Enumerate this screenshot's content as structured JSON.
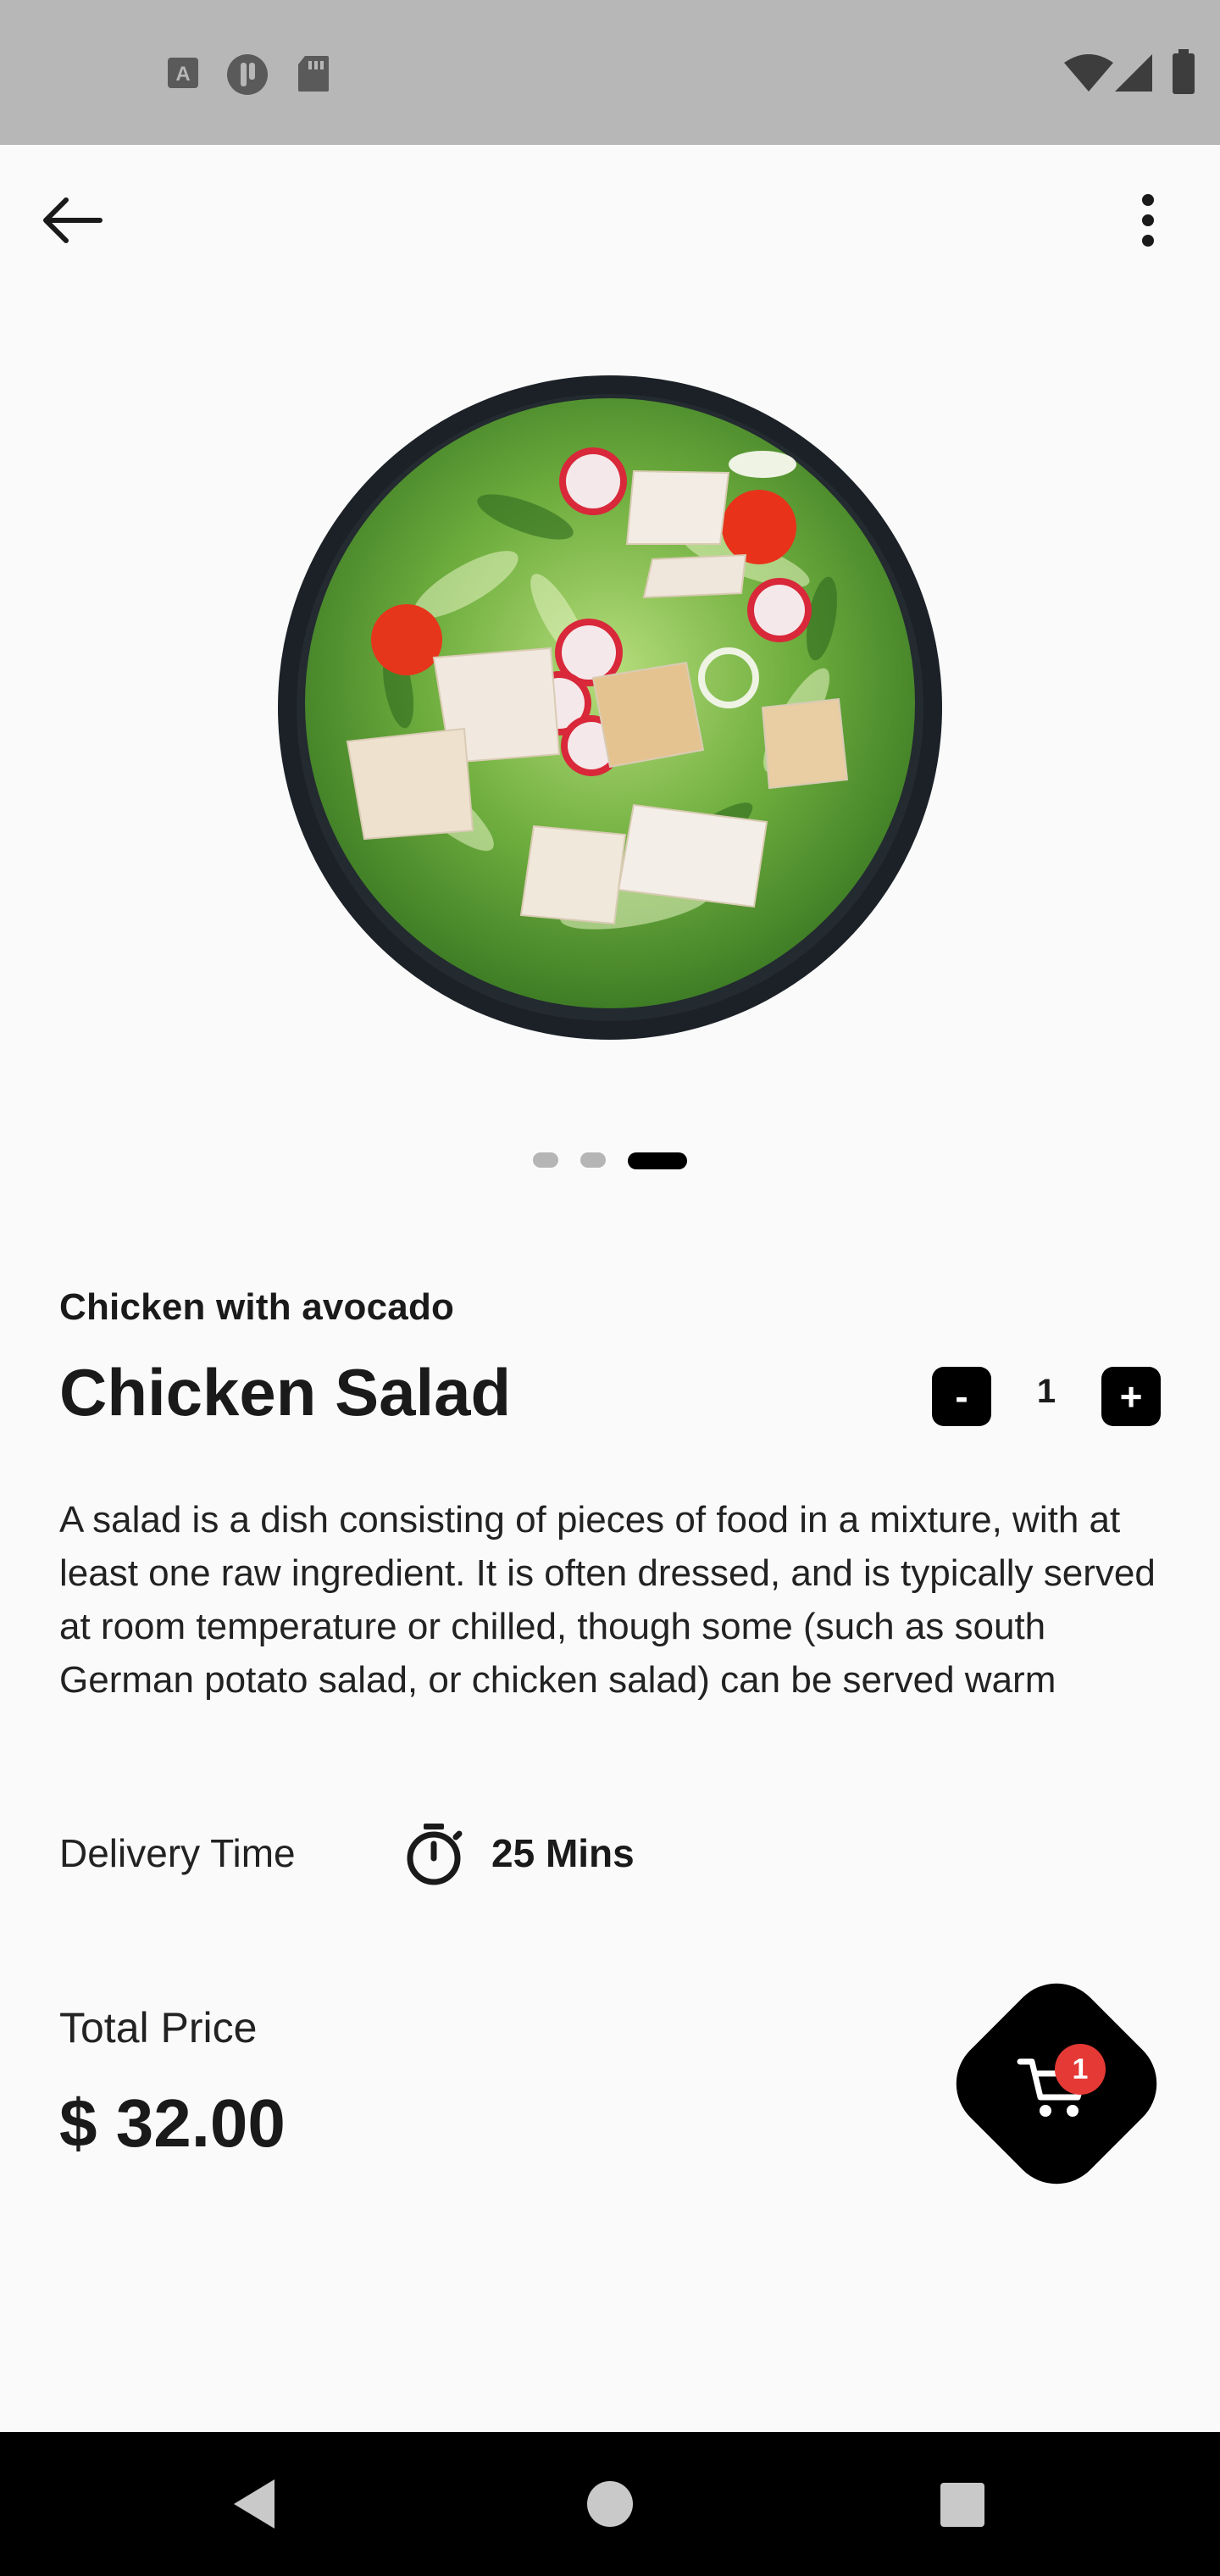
{
  "status_bar": {
    "left_icons": [
      "keyboard-a-icon",
      "sync-icon",
      "sd-card-icon"
    ],
    "right_icons": [
      "wifi-icon",
      "signal-icon",
      "battery-icon"
    ]
  },
  "app_bar": {
    "back_icon": "arrow-back-icon",
    "menu_icon": "more-vert-icon"
  },
  "carousel": {
    "page_count": 3,
    "active_index": 2
  },
  "product": {
    "subtitle": "Chicken with avocado",
    "title": "Chicken Salad",
    "quantity": {
      "minus_label": "-",
      "value": "1",
      "plus_label": "+"
    },
    "description": "A salad is a dish consisting of pieces of food in a mixture, with at least one raw ingredient. It is often dressed, and is typically served at room temperature or chilled, though some (such as south German potato salad, or chicken salad) can be served warm",
    "delivery": {
      "label": "Delivery Time",
      "value": "25 Mins"
    },
    "price": {
      "label": "Total Price",
      "value": "$ 32.00"
    }
  },
  "cart": {
    "badge": "1",
    "badge_color": "#e53935"
  },
  "nav": {
    "icons": [
      "nav-back-icon",
      "nav-home-icon",
      "nav-recents-icon"
    ]
  }
}
